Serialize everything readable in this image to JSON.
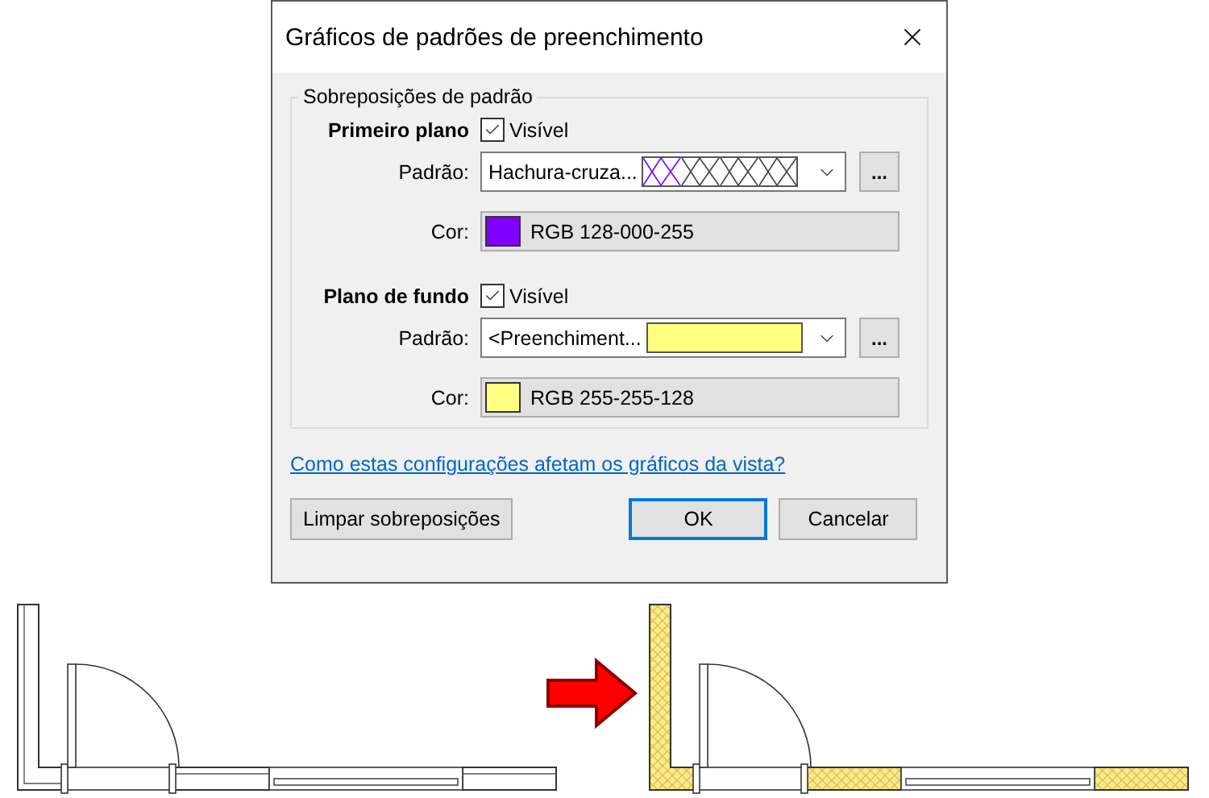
{
  "dialog": {
    "title": "Gráficos de padrões de preenchimento",
    "group": {
      "title": "Sobreposições de padrão",
      "sections": [
        {
          "heading": "Primeiro plano",
          "visible_label": "Visível",
          "visible": true,
          "pattern_label": "Padrão:",
          "pattern_value": "Hachura-cruza...",
          "kind": "crosshatch",
          "browse_label": "...",
          "color_label": "Cor:",
          "color": "#8000ff",
          "color_value": "RGB 128-000-255"
        },
        {
          "heading": "Plano de fundo",
          "visible_label": "Visível",
          "visible": true,
          "pattern_label": "Padrão:",
          "pattern_value": "<Preenchiment...",
          "kind": "solid",
          "browse_label": "...",
          "color_label": "Cor:",
          "color": "#ffff80",
          "color_value": "RGB 255-255-128"
        }
      ]
    },
    "link": "Como estas configurações afetam os gráficos da vista?",
    "buttons": [
      {
        "label": "Limpar sobreposições",
        "default": false
      },
      {
        "label": "OK",
        "default": true
      },
      {
        "label": "Cancelar",
        "default": false
      }
    ]
  },
  "plans": [
    {
      "filled": false
    },
    {
      "filled": true
    }
  ]
}
